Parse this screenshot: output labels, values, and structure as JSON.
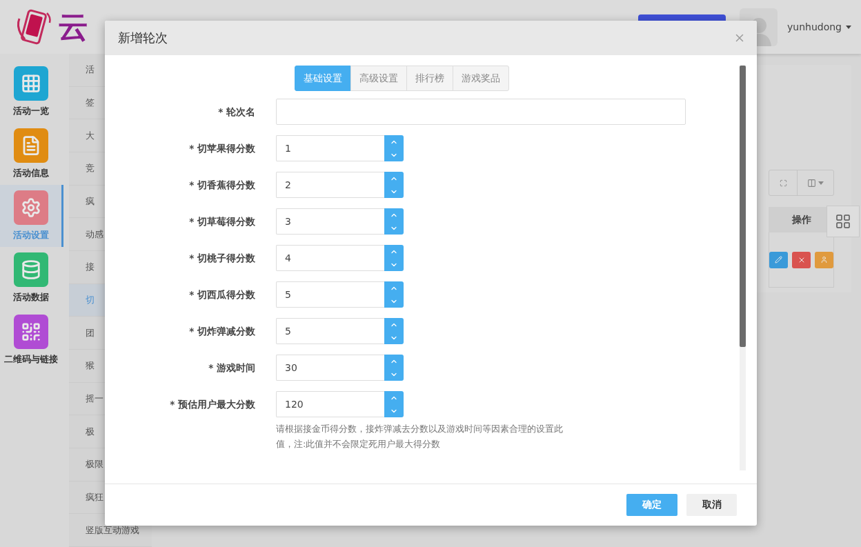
{
  "header": {
    "logo_text": "云",
    "user": {
      "name": "yunhudong"
    }
  },
  "nav": [
    {
      "label": "活动一览",
      "color": "#1ea6d2",
      "selected": false
    },
    {
      "label": "活动信息",
      "color": "#e08c12",
      "selected": false
    },
    {
      "label": "活动设置",
      "color": "#dd7c86",
      "selected": true
    },
    {
      "label": "活动数据",
      "color": "#31b874",
      "selected": false
    },
    {
      "label": "二维码与链接",
      "color": "#b04cd4",
      "selected": false
    }
  ],
  "subnav": [
    {
      "label": "活",
      "selected": false
    },
    {
      "label": "签",
      "selected": false
    },
    {
      "label": "大",
      "selected": false
    },
    {
      "label": "竞",
      "selected": false
    },
    {
      "label": "疯",
      "selected": false
    },
    {
      "label": "动感",
      "selected": false
    },
    {
      "label": "接",
      "selected": false
    },
    {
      "label": "切",
      "selected": true
    },
    {
      "label": "团",
      "selected": false
    },
    {
      "label": "猴",
      "selected": false
    },
    {
      "label": "摇一",
      "selected": false
    },
    {
      "label": "极",
      "selected": false
    },
    {
      "label": "极限",
      "selected": false
    },
    {
      "label": "疯狂",
      "selected": false
    },
    {
      "label": "竖版互动游戏",
      "selected": false
    }
  ],
  "table": {
    "columns": [
      "操作"
    ]
  },
  "dialog": {
    "title": "新增轮次",
    "tabs": [
      {
        "label": "基础设置",
        "selected": true
      },
      {
        "label": "高级设置",
        "selected": false
      },
      {
        "label": "排行榜",
        "selected": false
      },
      {
        "label": "游戏奖品",
        "selected": false
      }
    ],
    "fields": [
      {
        "label": "* 轮次名",
        "kind": "text"
      },
      {
        "label": "* 切苹果得分数",
        "kind": "number",
        "value": "1"
      },
      {
        "label": "* 切香蕉得分数",
        "kind": "number",
        "value": "2"
      },
      {
        "label": "* 切草莓得分数",
        "kind": "number",
        "value": "3"
      },
      {
        "label": "* 切桃子得分数",
        "kind": "number",
        "value": "4"
      },
      {
        "label": "* 切西瓜得分数",
        "kind": "number",
        "value": "5"
      },
      {
        "label": "* 切炸弹减分数",
        "kind": "number",
        "value": "5"
      },
      {
        "label": "* 游戏时间",
        "kind": "number",
        "value": "30"
      },
      {
        "label": "* 预估用户最大分数",
        "kind": "number",
        "value": "120"
      }
    ],
    "hint": "请根据接金币得分数，接炸弹减去分数以及游戏时间等因素合理的设置此值，注:此值并不会限定死用户最大得分数",
    "buttons": [
      {
        "label": "确定",
        "kind": "primary"
      },
      {
        "label": "取消",
        "kind": "default"
      }
    ]
  }
}
